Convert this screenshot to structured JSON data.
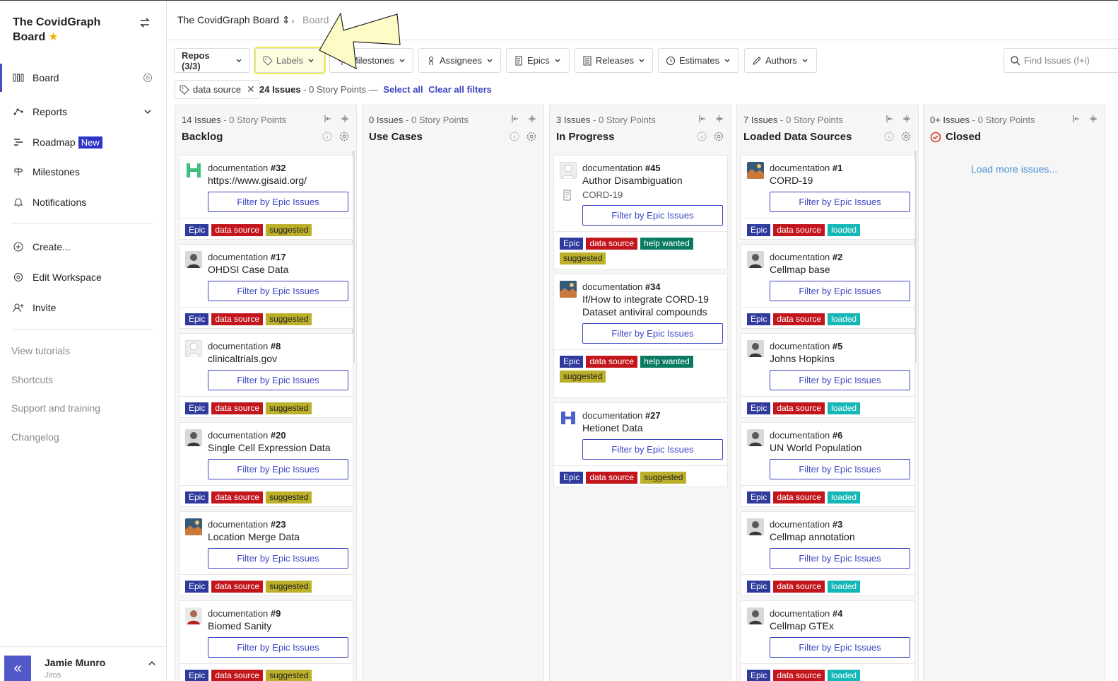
{
  "sidebar": {
    "workspace_title": "The CovidGraph Board",
    "nav": {
      "board": "Board",
      "reports": "Reports",
      "roadmap": "Roadmap",
      "roadmap_badge": "New",
      "milestones": "Milestones",
      "notifications": "Notifications",
      "create": "Create...",
      "edit_workspace": "Edit Workspace",
      "invite": "Invite"
    },
    "links": {
      "tutorials": "View tutorials",
      "shortcuts": "Shortcuts",
      "support": "Support and training",
      "changelog": "Changelog"
    },
    "user": {
      "name": "Jamie Munro",
      "org": "Jiros",
      "collapse": "«"
    }
  },
  "breadcrumb": {
    "board": "The CovidGraph Board",
    "current": "Board"
  },
  "filters": {
    "repos": "Repos (3/3)",
    "labels": "Labels",
    "milestones": "Milestones",
    "assignees": "Assignees",
    "epics": "Epics",
    "releases": "Releases",
    "estimates": "Estimates",
    "authors": "Authors",
    "search_placeholder": "Find Issues (f+i)"
  },
  "active_filter": {
    "chip": "data source",
    "issues": "24 Issues",
    "points": "- 0 Story Points —",
    "select_all": "Select all",
    "clear_all": "Clear all filters"
  },
  "epic_button": "Filter by Epic Issues",
  "colors": {
    "accent": "#3d45c2",
    "epic": "#2f3a9c",
    "data_source": "#c2161c",
    "suggested": "#bcb02b",
    "help_wanted": "#0b7a63",
    "loaded": "#14b6b6"
  },
  "columns": [
    {
      "count": "14 Issues",
      "points": " - 0 Story Points",
      "title": "Backlog",
      "cards": [
        {
          "repo": "documentation",
          "num": "#32",
          "title": "https://www.gisaid.org/",
          "avatar": "green-pattern",
          "labels": [
            "Epic",
            "data source",
            "suggested"
          ]
        },
        {
          "repo": "documentation",
          "num": "#17",
          "title": "OHDSI Case Data",
          "avatar": "person",
          "labels": [
            "Epic",
            "data source",
            "suggested"
          ]
        },
        {
          "repo": "documentation",
          "num": "#8",
          "title": "clinicaltrials.gov",
          "avatar": "blank",
          "labels": [
            "Epic",
            "data source",
            "suggested"
          ]
        },
        {
          "repo": "documentation",
          "num": "#20",
          "title": "Single Cell Expression Data",
          "avatar": "person",
          "labels": [
            "Epic",
            "data source",
            "suggested"
          ]
        },
        {
          "repo": "documentation",
          "num": "#23",
          "title": "Location Merge Data",
          "avatar": "landscape",
          "labels": [
            "Epic",
            "data source",
            "suggested"
          ]
        },
        {
          "repo": "documentation",
          "num": "#9",
          "title": "Biomed Sanity",
          "avatar": "person-red",
          "labels": [
            "Epic",
            "data source",
            "suggested"
          ]
        }
      ]
    },
    {
      "count": "0 Issues",
      "points": " - 0 Story Points",
      "title": "Use Cases",
      "cards": []
    },
    {
      "count": "3 Issues",
      "points": " - 0 Story Points",
      "title": "In Progress",
      "cards": [
        {
          "repo": "documentation",
          "num": "#45",
          "title": "Author Disambiguation",
          "sub": "CORD-19",
          "avatar": "blank",
          "labels": [
            "Epic",
            "data source",
            "help wanted",
            "suggested"
          ]
        },
        {
          "repo": "documentation",
          "num": "#34",
          "title": "If/How to integrate CORD-19 Dataset antiviral compounds",
          "avatar": "landscape",
          "labels": [
            "Epic",
            "data source",
            "help wanted",
            "suggested"
          ]
        },
        {
          "repo": "documentation",
          "num": "#27",
          "title": "Hetionet Data",
          "avatar": "blue-logo",
          "labels": [
            "Epic",
            "data source",
            "suggested"
          ]
        }
      ]
    },
    {
      "count": "7 Issues",
      "points": " - 0 Story Points",
      "title": "Loaded Data Sources",
      "cards": [
        {
          "repo": "documentation",
          "num": "#1",
          "title": "CORD-19",
          "avatar": "landscape",
          "labels": [
            "Epic",
            "data source",
            "loaded"
          ]
        },
        {
          "repo": "documentation",
          "num": "#2",
          "title": "Cellmap base",
          "avatar": "person",
          "labels": [
            "Epic",
            "data source",
            "loaded"
          ]
        },
        {
          "repo": "documentation",
          "num": "#5",
          "title": "Johns Hopkins",
          "avatar": "person",
          "labels": [
            "Epic",
            "data source",
            "loaded"
          ]
        },
        {
          "repo": "documentation",
          "num": "#6",
          "title": "UN World Population",
          "avatar": "person",
          "labels": [
            "Epic",
            "data source",
            "loaded"
          ]
        },
        {
          "repo": "documentation",
          "num": "#3",
          "title": "Cellmap annotation",
          "avatar": "person",
          "labels": [
            "Epic",
            "data source",
            "loaded"
          ]
        },
        {
          "repo": "documentation",
          "num": "#4",
          "title": "Cellmap GTEx",
          "avatar": "person",
          "labels": [
            "Epic",
            "data source",
            "loaded"
          ]
        }
      ]
    },
    {
      "count": "0+ Issues",
      "points": " - 0 Story Points",
      "title": "Closed",
      "load_more": "Load more issues...",
      "cards": []
    }
  ]
}
